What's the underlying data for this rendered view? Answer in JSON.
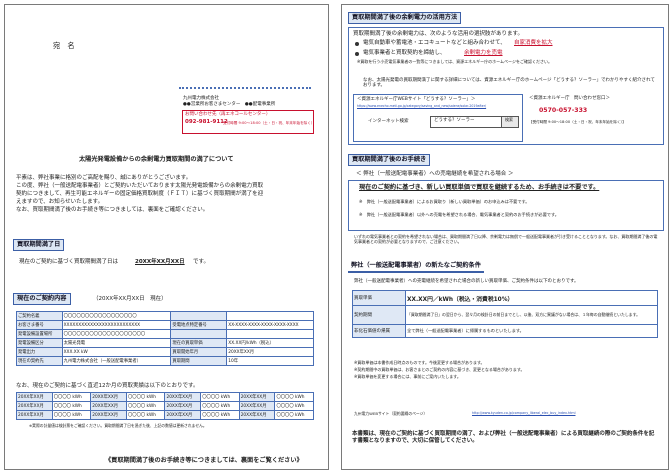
{
  "left": {
    "recipient": "宛　名",
    "sender": {
      "company": "九州電力株式会社",
      "center": "●●営業所お客さまセンター　●●配電事業所",
      "contact_label": "お問い合わせ先（再エネコールセンター）",
      "phone": "092-981-9112",
      "hours": "受付時間 9:00～18:00（土・日・祝、年末年始を除く）"
    },
    "title": "太陽光発電設備からの余剰電力買取期間の満了について",
    "intro": [
      "平素は、弊社事業に格別のご高配を賜り、誠にありがとうございます。",
      "この度、弊社（一般送配電事業者）とご契約いただいております太陽光発電設備からの余剰電力買取",
      "契約につきまして、再生可能エネルギーの固定価格買取制度（ＦＩＴ）に基づく買取期間が満了を迎",
      "えますので、お知らせいたします。",
      "なお、買取期間満了後のお手続き等につきましては、裏面をご確認ください。"
    ],
    "section1": {
      "heading": "買取期間満了日",
      "text": "現在のご契約に基づく買取期間満了日は",
      "date": "20XX年XX月XX日",
      "suffix": "です。"
    },
    "section2": {
      "heading": "現在のご契約内容",
      "as_of": "（20XX年XX月XX日　現在）"
    },
    "contract_table": [
      [
        "ご契約名義",
        "〇〇〇〇〇〇〇〇〇〇〇〇〇〇〇〇〇",
        "",
        ""
      ],
      [
        "お客さま番号",
        "XXXXXXXXXXXXXXXXXXXXXXXXXX",
        "受電地点特定番号",
        "XX-XXXX-XXXX-XXXX-XXXX-XXXX"
      ],
      [
        "発電設備設置場所",
        "〇〇〇〇〇〇〇〇〇〇〇〇〇〇〇〇〇〇〇",
        "",
        ""
      ],
      [
        "発電設備区分",
        "太陽光発電",
        "現在の買取単価",
        "XX.XX円/kWh（税込）"
      ],
      [
        "発電出力",
        "XXX.XX kW",
        "買取開始年月",
        "20XX年XX月"
      ],
      [
        "現在の契約先",
        "九州電力株式会社（一般送配電事業者）",
        "買取期間",
        "10年"
      ]
    ],
    "record_note": "なお、現在のご契約に基づく直近12か月の買取実績は以下のとおりです。",
    "record_cells": [
      "20XX年XX月",
      "〇〇〇〇 kWh",
      "20XX年XX月",
      "〇〇〇〇 kWh",
      "20XX年XX月",
      "〇〇〇〇 kWh",
      "20XX年XX月",
      "〇〇〇〇 kWh"
    ],
    "record_footnote": "※実際の計量値は検針票をご確認ください。買取期間満了日を過ぎた後、上記の数値は更新されません。",
    "closing": "《買取期間満了後のお手続き等につきましては、裏面をご覧ください》"
  },
  "right": {
    "section3": {
      "heading": "買取期間満了後の余剰電力の活用方法",
      "intro": "買取期間満了後の余剰電力は、次のような活用の選択肢があります。",
      "bullets": [
        {
          "text": "電気自動車や蓄電池・エコキュートなどと組み合わせて、",
          "emph": "自家消費を拡大"
        },
        {
          "text": "電気事業者と買取契約を締結し、",
          "emph": "余剰電力を売電"
        }
      ],
      "note": "※買取を行う小売電気事業者の一覧等につきましては、資源エネルギー庁のホームページをご確認ください。",
      "detail": "なお、太陽光発電の買取期間満了に関する詳細については、資源エネルギー庁のホームページ「どうする？ソーラー」でわかりやすく紹介されております。",
      "site_label": "＜資源エネルギー庁WEBサイト「どうする？ソーラー」＞",
      "site_url": "https://www.enecho.meti.go.jp/category/saving_and_new/saiene/solar-2019after/",
      "search_label": "インターネット検索",
      "search_box": "どうする？ソーラー",
      "search_button": "検索",
      "contact_label": "＜資源エネルギー庁　問い合わせ窓口＞",
      "contact_phone": "0570-057-333",
      "contact_hours": "【受付時間 9:00～18:00（土・日・祝、年末年始を除く）】"
    },
    "section4": {
      "heading": "買取期間満了後のお手続き",
      "case_label": "＜ 弊社（一般送配電事業者）への売電継続を希望される場合 ＞",
      "headline": "現在のご契約に基づき、新しい買取単価で買取を継続するため、お手続きは不要です。",
      "notes": [
        "※　弊社（一般送配電事業者）によるお買取り（新しい買取単価）のお申込みは不要です。",
        "※　弊社（一般送配電事業者）以外への売電を希望される場合、電気事業者と契約のお手続きが必要です。"
      ],
      "paragraph": "いずれの電気事業者との契約を希望されない場合は、買取期間満了日以降、余剰電力は無償で一般送配電事業者が引き受けることとなります。なお、買取期間満了後の電気事業者との契約が必要となりますので、ご注意ください。"
    },
    "section5": {
      "heading": "弊社（一般送配電事業者）の新たなご契約条件",
      "intro": "弊社（一般送配電事業者）への売電継続を希望された場合の新しい買取単価、ご契約条件は以下のとおりです。",
      "rows": [
        [
          "買取単価",
          "XX.XX円／kWh（税込・消費税10%）"
        ],
        [
          "契約期間",
          "「買取期間満了日」の翌日から、翌々月の検針日の前日までとし、以後、双方に異議がない場合は、１年毎の自動継続といたします。"
        ],
        [
          "非化石価値の帰属",
          "全て弊社（一般送配電事業者）に帰属するものといたします。"
        ]
      ],
      "notes": [
        "※買取単価は本書作成日時点のものです。今後変更する場合があります。",
        "※契約期間中の買取単価は、お客さまとのご契約の内容に基づき、変更となる場合があります。",
        "※買取単価を変更する場合には、事前にご案内いたします。"
      ],
      "link_label": "九州電力WEBサイト（契約要綱のページ）",
      "link_url": "http://www.kyuden.co.jp/company_liberal_elec_buy_index.html"
    },
    "footer": "本書類は、現在のご契約に基づく買取期間の満了、および弊社（一般送配電事業者）による買取継続の際のご契約条件を記す書類となりますので、大切に保管してください。"
  },
  "colors": {
    "heading_bg": "#dde7f4",
    "heading_border": "#3c5fa6",
    "accent_red": "#c8102e",
    "table_border": "#4a6fb5"
  }
}
